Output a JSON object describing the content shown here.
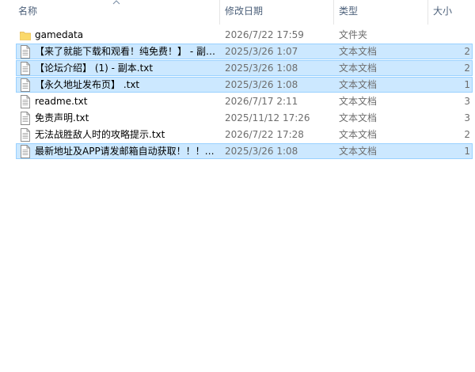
{
  "columns": {
    "name": "名称",
    "date": "修改日期",
    "type": "类型",
    "size": "大小"
  },
  "files": [
    {
      "name": "gamedata",
      "date": "2026/7/22 17:59",
      "type": "文件夹",
      "size": "",
      "icon": "folder-icon",
      "selected": false
    },
    {
      "name": "【来了就能下载和观看！纯免费！】 - 副…",
      "date": "2025/3/26 1:07",
      "type": "文本文档",
      "size": "2",
      "icon": "text-file-icon",
      "selected": true
    },
    {
      "name": "【论坛介绍】 (1) - 副本.txt",
      "date": "2025/3/26 1:08",
      "type": "文本文档",
      "size": "2",
      "icon": "text-file-icon",
      "selected": true
    },
    {
      "name": "【永久地址发布页】 .txt",
      "date": "2025/3/26 1:08",
      "type": "文本文档",
      "size": "1",
      "icon": "text-file-icon",
      "selected": true
    },
    {
      "name": "readme.txt",
      "date": "2026/7/17 2:11",
      "type": "文本文档",
      "size": "3",
      "icon": "text-file-icon",
      "selected": false
    },
    {
      "name": "免责声明.txt",
      "date": "2025/11/12 17:26",
      "type": "文本文档",
      "size": "3",
      "icon": "text-file-icon",
      "selected": false
    },
    {
      "name": "无法战胜敌人时的攻略提示.txt",
      "date": "2026/7/22 17:28",
      "type": "文本文档",
      "size": "2",
      "icon": "text-file-icon",
      "selected": false
    },
    {
      "name": "最新地址及APP请发邮箱自动获取！！！…",
      "date": "2025/3/26 1:08",
      "type": "文本文档",
      "size": "1",
      "icon": "text-file-icon",
      "selected": true
    }
  ]
}
